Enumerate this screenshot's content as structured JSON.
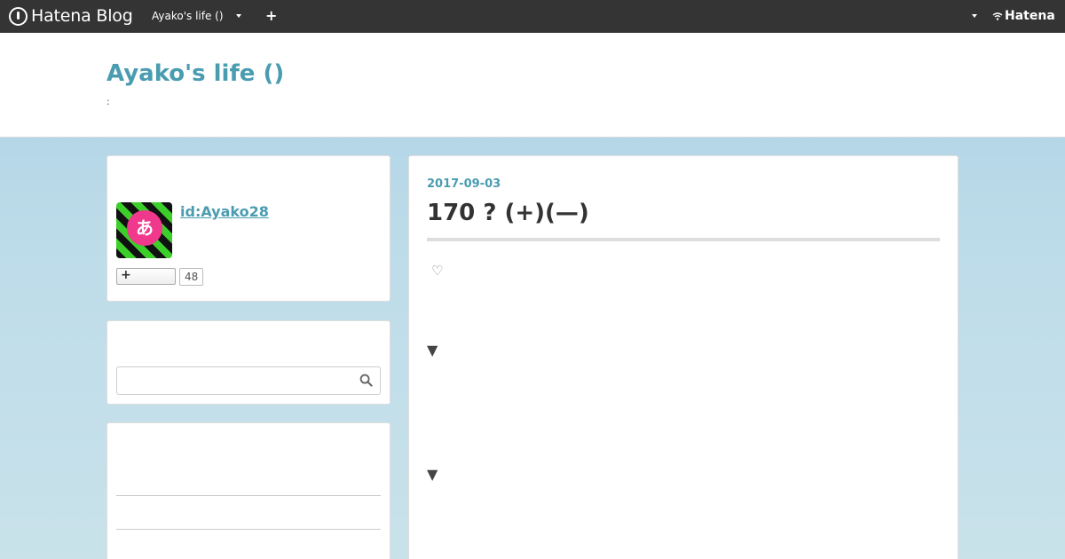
{
  "globalbar": {
    "logo_text": "Hatena Blog",
    "blog_switch_label": "Ayako's life ()",
    "add_label": "+",
    "hatena_label": "Hatena"
  },
  "header": {
    "title": "Ayako's life ()",
    "description": ":"
  },
  "sidebar": {
    "profile": {
      "avatar_glyph": "あ",
      "user_id": "id:Ayako28",
      "follow_plus": "+",
      "follower_count": "48"
    },
    "search": {
      "placeholder": ""
    }
  },
  "entry": {
    "date": "2017-09-03",
    "title": "170 ? (+)(—)",
    "heart": "♡",
    "toggle_1": "▼",
    "toggle_2": "▼"
  },
  "colors": {
    "accent": "#4a9cb0",
    "topbar": "#343434",
    "avatar_pink": "#f0388d",
    "avatar_green": "#3ccf2a"
  }
}
